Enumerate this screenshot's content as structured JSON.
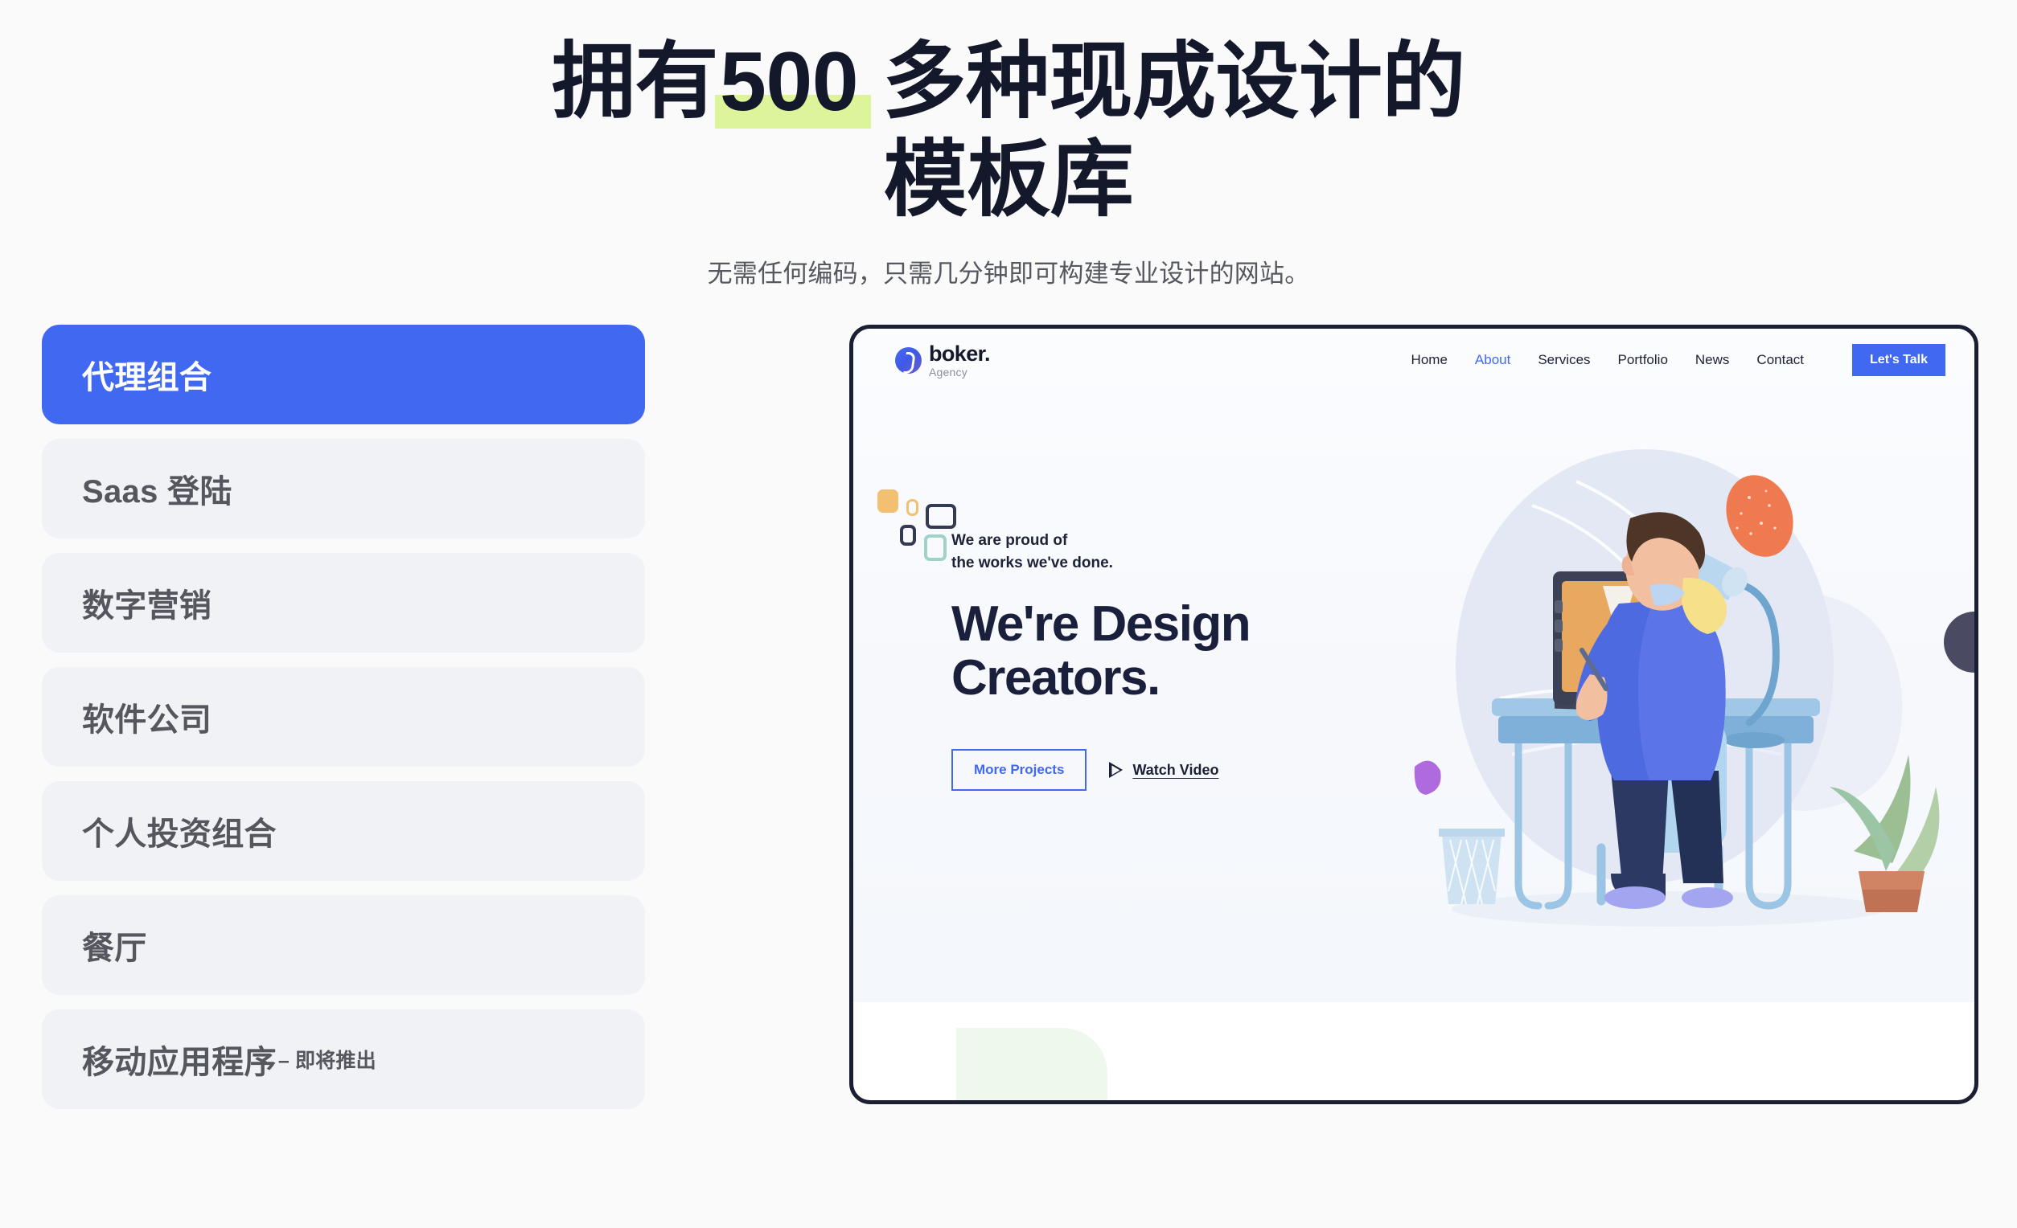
{
  "page": {
    "title_line1_prefix": "拥有",
    "title_highlight": "500",
    "title_line1_suffix": " 多种现成设计的",
    "title_line2": "模板库",
    "subtitle": "无需任何编码，只需几分钟即可构建专业设计的网站。",
    "highlight_color": "#ddf59a",
    "accent_color": "#4168f0",
    "background_color": "#fafafb"
  },
  "categories": [
    {
      "label": "代理组合",
      "badge": "",
      "active": true
    },
    {
      "label": "Saas 登陆",
      "badge": "",
      "active": false
    },
    {
      "label": "数字营销",
      "badge": "",
      "active": false
    },
    {
      "label": "软件公司",
      "badge": "",
      "active": false
    },
    {
      "label": "个人投资组合",
      "badge": "",
      "active": false
    },
    {
      "label": "餐厅",
      "badge": "",
      "active": false
    },
    {
      "label": "移动应用程序",
      "badge": "– 即将推出",
      "active": false
    }
  ],
  "preview": {
    "logo": {
      "name": "boker.",
      "sub": "Agency"
    },
    "nav_links": [
      {
        "label": "Home",
        "active": false
      },
      {
        "label": "About",
        "active": true
      },
      {
        "label": "Services",
        "active": false
      },
      {
        "label": "Portfolio",
        "active": false
      },
      {
        "label": "News",
        "active": false
      },
      {
        "label": "Contact",
        "active": false
      }
    ],
    "nav_cta": "Let's Talk",
    "hero": {
      "kicker_line1": "We are proud of",
      "kicker_line2": "the works we've done.",
      "title_line1": "We're Design",
      "title_line2": "Creators.",
      "primary_button": "More Projects",
      "secondary_link": "Watch Video"
    }
  }
}
